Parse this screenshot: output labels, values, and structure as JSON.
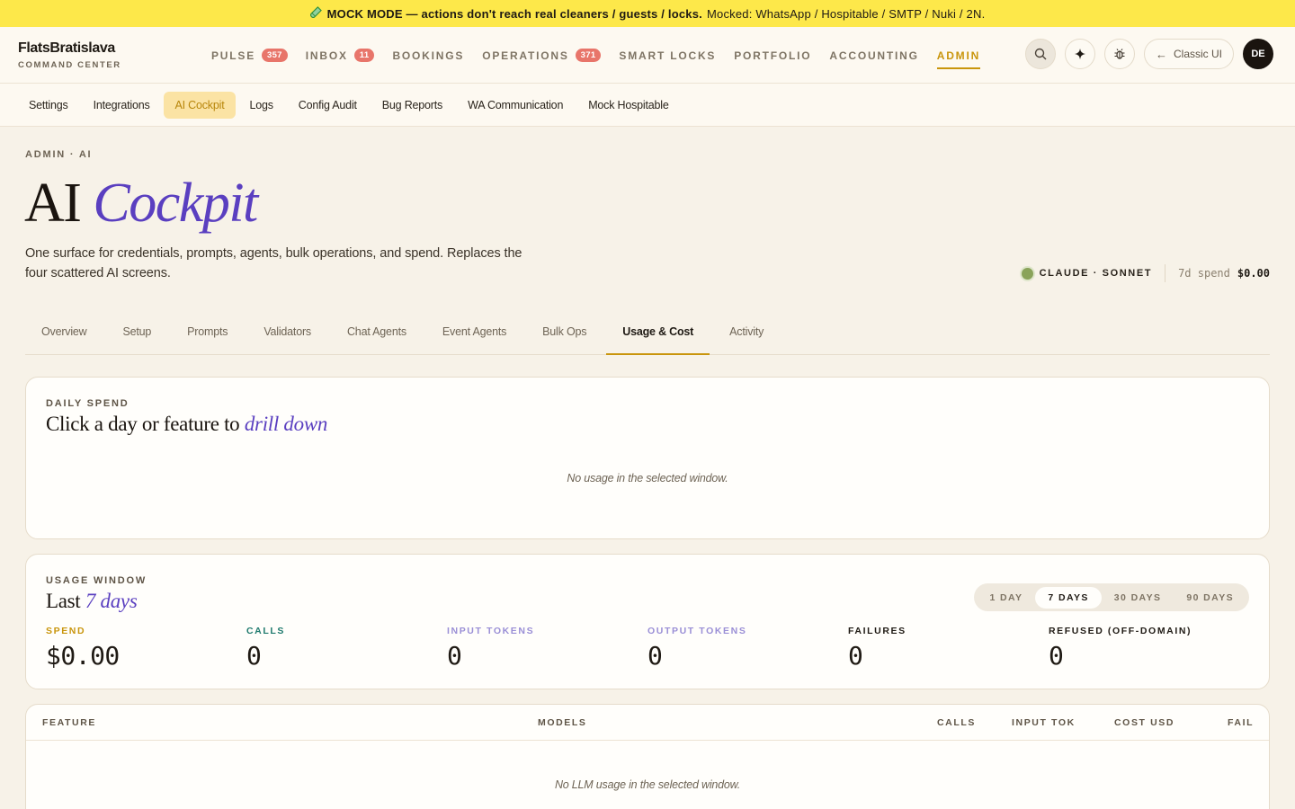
{
  "banner": {
    "icon": "test-tube-icon",
    "strong": "MOCK MODE — actions don't reach real cleaners / guests / locks.",
    "detail": "Mocked: WhatsApp / Hospitable / SMTP / Nuki / 2N."
  },
  "brand": {
    "name": "FlatsBratislava",
    "sub": "COMMAND CENTER"
  },
  "nav": [
    {
      "label": "PULSE",
      "badge": "357"
    },
    {
      "label": "INBOX",
      "badge": "11"
    },
    {
      "label": "BOOKINGS",
      "badge": null
    },
    {
      "label": "OPERATIONS",
      "badge": "371"
    },
    {
      "label": "SMART LOCKS",
      "badge": null
    },
    {
      "label": "PORTFOLIO",
      "badge": null
    },
    {
      "label": "ACCOUNTING",
      "badge": null
    },
    {
      "label": "ADMIN",
      "badge": null,
      "active": true
    }
  ],
  "tools": {
    "classic_label": "Classic UI",
    "avatar": "DE"
  },
  "subnav": [
    "Settings",
    "Integrations",
    "AI Cockpit",
    "Logs",
    "Config Audit",
    "Bug Reports",
    "WA Communication",
    "Mock Hospitable"
  ],
  "page": {
    "crumb": "ADMIN · AI",
    "title_plain": "AI",
    "title_em": "Cockpit",
    "description": "One surface for credentials, prompts, agents, bulk operations, and spend. Replaces the four scattered AI screens.",
    "model": "CLAUDE · SONNET",
    "spend_label": "7d spend",
    "spend_value": "$0.00",
    "status_color": "#8aa35a"
  },
  "tabs": [
    "Overview",
    "Setup",
    "Prompts",
    "Validators",
    "Chat Agents",
    "Event Agents",
    "Bulk Ops",
    "Usage & Cost",
    "Activity"
  ],
  "daily": {
    "kicker": "DAILY SPEND",
    "title_plain": "Click a day or feature to",
    "title_em": "drill down",
    "empty": "No usage in the selected window."
  },
  "window": {
    "kicker": "USAGE WINDOW",
    "title_plain": "Last",
    "title_em": "7 days",
    "ranges": [
      "1 DAY",
      "7 DAYS",
      "30 DAYS",
      "90 DAYS"
    ],
    "metrics": [
      {
        "label": "SPEND",
        "value": "$0.00",
        "color": "#c9950c"
      },
      {
        "label": "CALLS",
        "value": "0",
        "color": "#1f7a6e"
      },
      {
        "label": "INPUT TOKENS",
        "value": "0",
        "color": "#9a8fd6"
      },
      {
        "label": "OUTPUT TOKENS",
        "value": "0",
        "color": "#9a8fd6"
      },
      {
        "label": "FAILURES",
        "value": "0",
        "color": "#1f1a14"
      },
      {
        "label": "REFUSED (OFF-DOMAIN)",
        "value": "0",
        "color": "#1f1a14"
      }
    ]
  },
  "table": {
    "headers": [
      "FEATURE",
      "MODELS",
      "CALLS",
      "INPUT TOK",
      "COST USD",
      "FAIL"
    ],
    "empty": "No LLM usage in the selected window."
  }
}
